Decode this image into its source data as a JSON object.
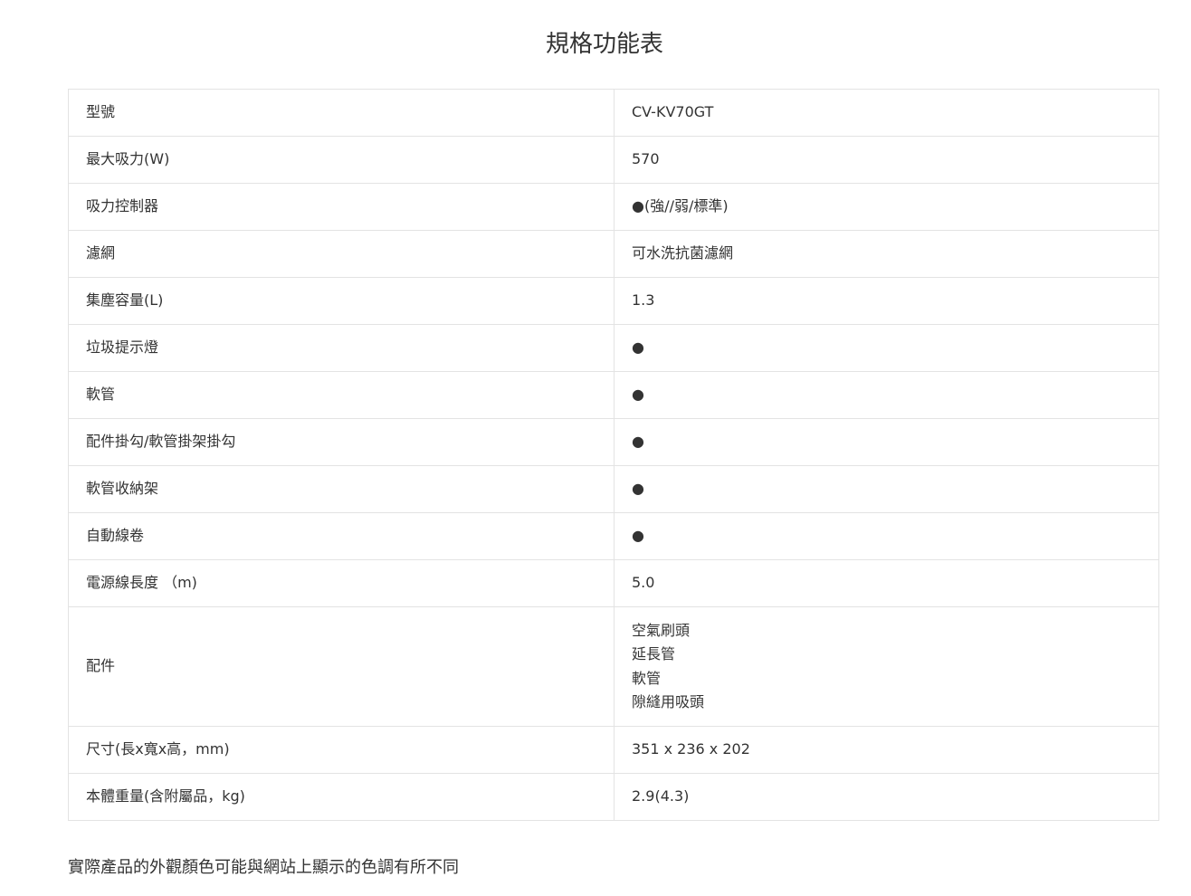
{
  "page": {
    "title": "規格功能表",
    "footnote": "實際產品的外觀顏色可能與網站上顯示的色調有所不同"
  },
  "spec_rows": [
    {
      "label": "型號",
      "value": "CV-KV70GT"
    },
    {
      "label": "最大吸力(W)",
      "value": "570"
    },
    {
      "label": "吸力控制器",
      "value": "●(強//弱/標準)"
    },
    {
      "label": "濾網",
      "value": "可水洗抗菌濾網"
    },
    {
      "label": "集塵容量(L)",
      "value": "1.3"
    },
    {
      "label": "垃圾提示燈",
      "value": "●"
    },
    {
      "label": "軟管",
      "value": "●"
    },
    {
      "label": "配件掛勾/軟管掛架掛勾",
      "value": "●"
    },
    {
      "label": "軟管收納架",
      "value": "●"
    },
    {
      "label": "自動線卷",
      "value": "●"
    },
    {
      "label": "電源線長度 （m)",
      "value": "5.0"
    },
    {
      "label": "配件",
      "values": [
        "空氣刷頭",
        "延長管",
        "軟管",
        "隙縫用吸頭"
      ]
    },
    {
      "label": "尺寸(長x寬x高，mm)",
      "value": "351 x 236 x 202"
    },
    {
      "label": "本體重量(含附屬品，kg)",
      "value": "2.9(4.3)"
    }
  ]
}
